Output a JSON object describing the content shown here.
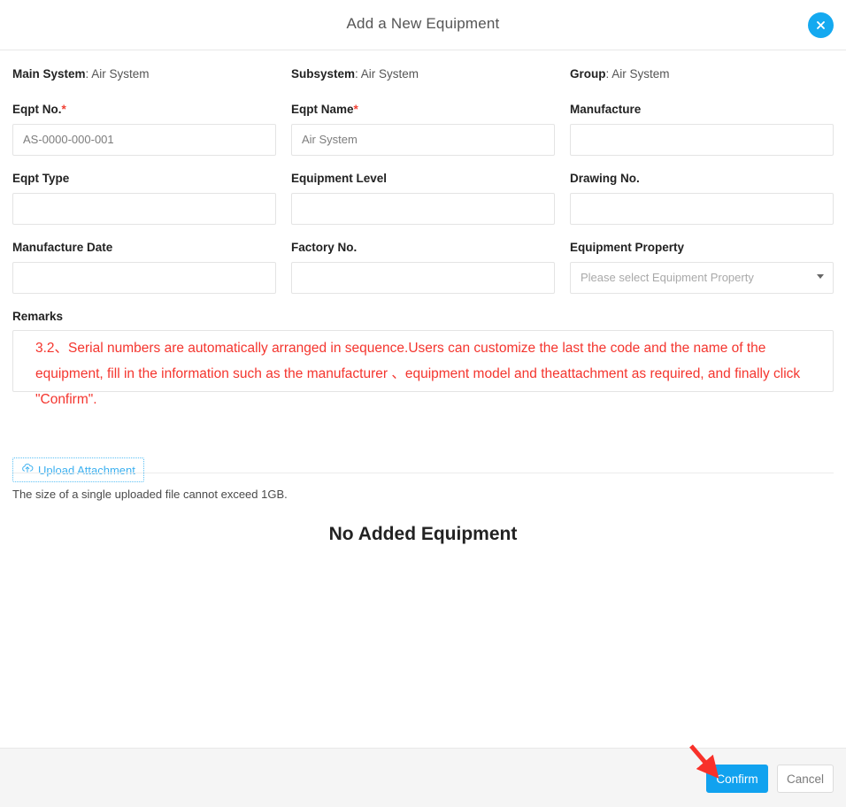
{
  "header": {
    "title": "Add a New Equipment",
    "close_icon": "close-icon"
  },
  "context": {
    "main_system_label": "Main System",
    "main_system_value": "Air System",
    "subsystem_label": "Subsystem",
    "subsystem_value": "Air System",
    "group_label": "Group",
    "group_value": "Air System",
    "separator": ": "
  },
  "form": {
    "eqpt_no": {
      "label": "Eqpt No.",
      "required_mark": "*",
      "value": "AS-0000-000-001"
    },
    "eqpt_name": {
      "label": "Eqpt Name",
      "required_mark": "*",
      "value": "Air System"
    },
    "manufacture": {
      "label": "Manufacture",
      "value": ""
    },
    "eqpt_type": {
      "label": "Eqpt Type",
      "value": ""
    },
    "equipment_level": {
      "label": "Equipment Level",
      "value": ""
    },
    "drawing_no": {
      "label": "Drawing No.",
      "value": ""
    },
    "manufacture_date": {
      "label": "Manufacture Date",
      "value": ""
    },
    "factory_no": {
      "label": "Factory No.",
      "value": ""
    },
    "equipment_property": {
      "label": "Equipment Property",
      "placeholder": "Please select Equipment Property",
      "selected": ""
    },
    "remarks": {
      "label": "Remarks",
      "value": "3.2、Serial numbers are automatically arranged in sequence.Users can customize the last the code and the name of the equipment, fill in the information such as the manufacturer 、equipment model and theattachment as required, and finally click \"Confirm\"."
    }
  },
  "upload": {
    "button_label": "Upload Attachment",
    "icon": "cloud-upload-icon",
    "hint": "The size of a single uploaded file cannot exceed 1GB."
  },
  "list": {
    "empty_message": "No Added Equipment"
  },
  "footer": {
    "confirm_label": "Confirm",
    "cancel_label": "Cancel"
  },
  "colors": {
    "accent_blue": "#11a2ef",
    "close_blue": "#14a9f0",
    "required_red": "#f04134",
    "remarks_red": "#f4352e",
    "annotation_red": "#f8312a",
    "footer_bg": "#f5f5f5",
    "border_gray": "#e4e4e4"
  }
}
